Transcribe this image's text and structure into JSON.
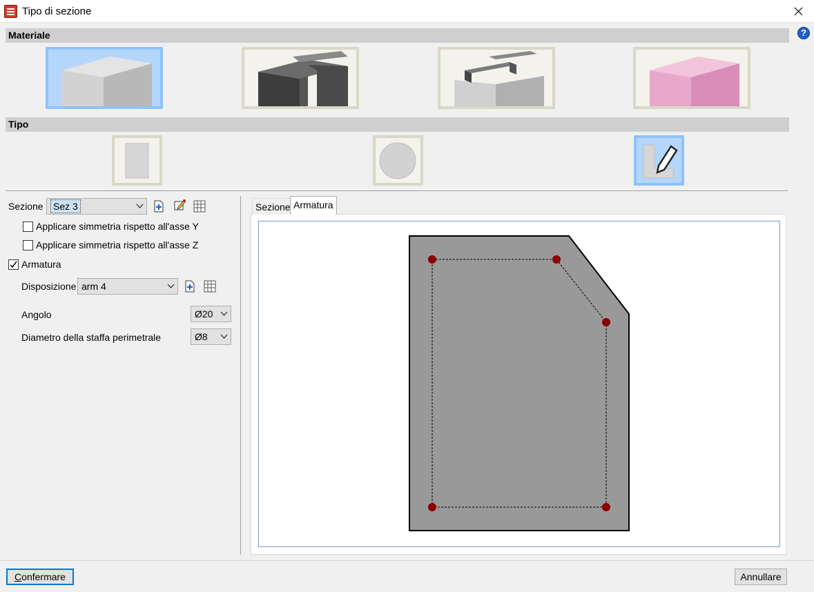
{
  "window": {
    "title": "Tipo di sezione"
  },
  "materiale": {
    "header": "Materiale",
    "options": [
      {
        "icon": "concrete-block-icon",
        "selected": true
      },
      {
        "icon": "steel-profile-icon",
        "selected": false
      },
      {
        "icon": "composite-section-icon",
        "selected": false
      },
      {
        "icon": "generic-material-block-icon",
        "selected": false
      }
    ]
  },
  "tipo": {
    "header": "Tipo",
    "options": [
      {
        "icon": "rectangular-section-icon",
        "selected": false
      },
      {
        "icon": "circular-section-icon",
        "selected": false
      },
      {
        "icon": "custom-section-edit-icon",
        "selected": true
      }
    ]
  },
  "left": {
    "sezione_label": "Sezione",
    "sezione_value": "Sez 3",
    "sym_y_label": "Applicare simmetria rispetto all'asse Y",
    "sym_y_checked": false,
    "sym_z_label": "Applicare simmetria rispetto all'asse Z",
    "sym_z_checked": false,
    "armatura_label": "Armatura",
    "armatura_checked": true,
    "disposizione_label": "Disposizione",
    "disposizione_value": "arm 4",
    "angolo_label": "Angolo",
    "angolo_value": "Ø20",
    "staffa_label": "Diametro della staffa perimetrale",
    "staffa_value": "Ø8"
  },
  "tabs": [
    {
      "label": "Sezione",
      "active": false
    },
    {
      "label": "Armatura",
      "active": true
    }
  ],
  "buttons": {
    "confirm": "Confermare",
    "confirm_accel": "C",
    "confirm_rest": "onfermare",
    "cancel": "Annullare"
  },
  "colors": {
    "selected_tile": "#b5d6fb",
    "tile_border": "#d9d7c6",
    "section_fill": "#999999",
    "rebar": "#8b0000"
  }
}
